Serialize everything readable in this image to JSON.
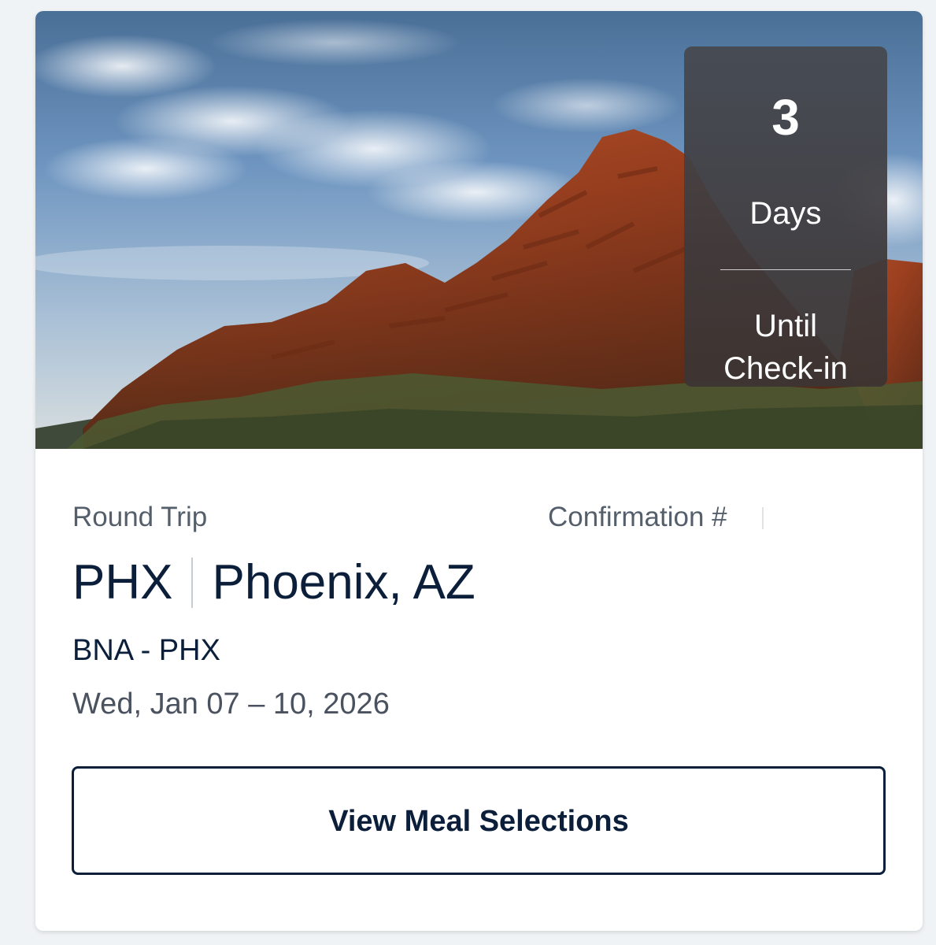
{
  "hero": {
    "image_subject": "red-rock-mountain-under-blue-sky",
    "countdown": {
      "number": "3",
      "unit": "Days",
      "caption_line1": "Until",
      "caption_line2": "Check-in"
    }
  },
  "trip": {
    "type_label": "Round Trip",
    "confirmation_label": "Confirmation #",
    "destination_code": "PHX",
    "destination_city": "Phoenix, AZ",
    "route": "BNA - PHX",
    "dates": "Wed, Jan 07 – 10, 2026"
  },
  "actions": {
    "meal_button_label": "View Meal Selections"
  },
  "colors": {
    "navy_text": "#0b1f3b",
    "muted_text": "#555f6b",
    "page_background": "#f0f3f5"
  }
}
